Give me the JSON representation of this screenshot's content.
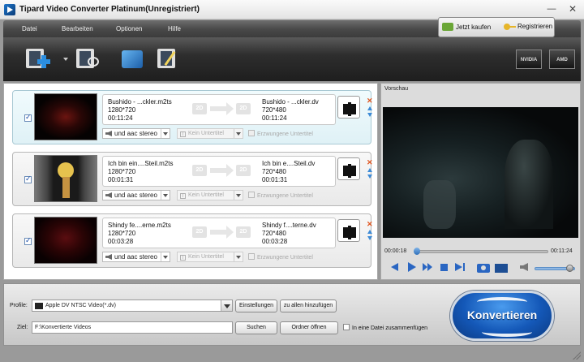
{
  "window": {
    "title": "Tipard Video Converter Platinum(Unregistriert)"
  },
  "menu": {
    "items": [
      "Datei",
      "Bearbeiten",
      "Optionen",
      "Hilfe"
    ]
  },
  "registration": {
    "buy_label": "Jetzt kaufen",
    "register_label": "Registrieren"
  },
  "toolbar": {
    "buttons": [
      "add-video-icon",
      "edit-clip-icon",
      "3d-icon",
      "effect-wand-icon"
    ],
    "gpu_badges": [
      "NVIDIA",
      "AMD"
    ]
  },
  "files": [
    {
      "src_name": "Bushido - ...ckler.m2ts",
      "src_res": "1280*720",
      "src_dur": "00:11:24",
      "dst_name": "Bushido - ...ckler.dv",
      "dst_res": "720*480",
      "dst_dur": "00:11:24",
      "conv_from": "2D",
      "conv_to": "2D",
      "audio": "und aac stereo",
      "subtitle": "Kein Untertitel",
      "forced": "Erzwungene Untertitel",
      "selected": true,
      "checked": true
    },
    {
      "src_name": "Ich bin ein....Steil.m2ts",
      "src_res": "1280*720",
      "src_dur": "00:01:31",
      "dst_name": "Ich bin e....Steil.dv",
      "dst_res": "720*480",
      "dst_dur": "00:01:31",
      "conv_from": "2D",
      "conv_to": "2D",
      "audio": "und aac stereo",
      "subtitle": "Kein Untertitel",
      "forced": "Erzwungene Untertitel",
      "selected": false,
      "checked": true
    },
    {
      "src_name": "Shindy fe....erne.m2ts",
      "src_res": "1280*720",
      "src_dur": "00:03:28",
      "dst_name": "Shindy f....terne.dv",
      "dst_res": "720*480",
      "dst_dur": "00:03:28",
      "conv_from": "2D",
      "conv_to": "2D",
      "audio": "und aac stereo",
      "subtitle": "Kein Untertitel",
      "forced": "Erzwungene Untertitel",
      "selected": false,
      "checked": true
    }
  ],
  "preview": {
    "title": "Vorschau",
    "time_current": "00:00:18",
    "time_total": "00:11:24",
    "progress": 0.026,
    "volume": 0.85
  },
  "bottom": {
    "profile_label": "Profile:",
    "profile_value": "Apple DV NTSC Video(*.dv)",
    "settings_btn": "Einstellungen",
    "apply_all_btn": "zu allen hinzufügen",
    "dest_label": "Ziel:",
    "dest_value": "F:\\Konvertierte Videos",
    "search_btn": "Suchen",
    "open_folder_btn": "Ordner öffnen",
    "merge_label": "In eine Datei zusammenfügen",
    "convert_btn": "Konvertieren"
  },
  "colors": {
    "accent": "#1458b8",
    "toolbar": "#2e2e2e",
    "selected_row": "#dff1f6"
  }
}
